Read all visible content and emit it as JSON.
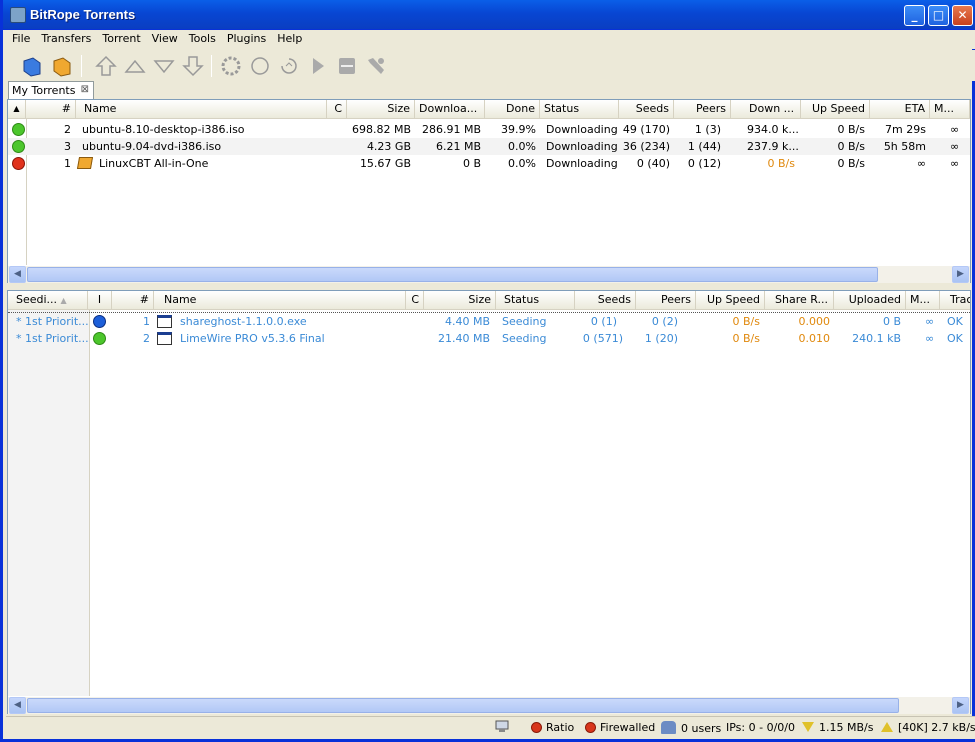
{
  "window": {
    "title": "BitRope Torrents",
    "min": "_",
    "max": "□",
    "close": "✕"
  },
  "menu": [
    "File",
    "Transfers",
    "Torrent",
    "View",
    "Tools",
    "Plugins",
    "Help"
  ],
  "tab": {
    "label": "My Torrents",
    "close": "⊠"
  },
  "torrents": {
    "columns": [
      "#",
      "Name",
      "C",
      "Size",
      "Downloa...",
      "Done",
      "Status",
      "Seeds",
      "Peers",
      "Down ...",
      "Up Speed",
      "ETA",
      "M..."
    ],
    "rows": [
      {
        "status_icon": "green-smiley-icon",
        "num": "2",
        "name": "ubuntu-8.10-desktop-i386.iso",
        "size": "698.82 MB",
        "downloaded": "286.91 MB",
        "done": "39.9%",
        "status": "Downloading",
        "seeds": "49 (170)",
        "peers": "1 (3)",
        "down": "934.0 k...",
        "up": "0 B/s",
        "eta": "7m 29s",
        "m": "∞"
      },
      {
        "status_icon": "green-smiley-icon",
        "num": "3",
        "name": "ubuntu-9.04-dvd-i386.iso",
        "size": "4.23 GB",
        "downloaded": "6.21 MB",
        "done": "0.0%",
        "status": "Downloading",
        "seeds": "36 (234)",
        "peers": "1 (44)",
        "down": "237.9 k...",
        "up": "0 B/s",
        "eta": "5h 58m",
        "m": "∞"
      },
      {
        "status_icon": "red-smiley-icon",
        "num": "1",
        "name": "LinuxCBT All-in-One",
        "size": "15.67 GB",
        "downloaded": "0 B",
        "done": "0.0%",
        "status": "Downloading",
        "seeds": "0 (40)",
        "peers": "0 (12)",
        "down": "0 B/s",
        "up": "0 B/s",
        "eta": "∞",
        "m": "∞"
      }
    ]
  },
  "seeding": {
    "columns": [
      "Seedi...",
      "I",
      "#",
      "Name",
      "C",
      "Size",
      "Status",
      "Seeds",
      "Peers",
      "Up Speed",
      "Share R...",
      "Uploaded",
      "M...",
      "Trac"
    ],
    "rows": [
      {
        "priority": "* 1st Priorit...",
        "icon": "blue-smiley-icon",
        "num": "1",
        "name": "shareghost-1.1.0.0.exe",
        "size": "4.40 MB",
        "status": "Seeding",
        "seeds": "0 (1)",
        "peers": "0 (2)",
        "up": "0 B/s",
        "ratio": "0.000",
        "uploaded": "0 B",
        "m": "∞",
        "trac": "OK"
      },
      {
        "priority": "* 1st Priorit...",
        "icon": "green-smiley-icon",
        "num": "2",
        "name": "LimeWire PRO v5.3.6 Final",
        "size": "21.40 MB",
        "status": "Seeding",
        "seeds": "0 (571)",
        "peers": "1 (20)",
        "up": "0 B/s",
        "ratio": "0.010",
        "uploaded": "240.1 kB",
        "m": "∞",
        "trac": "OK"
      }
    ]
  },
  "status": {
    "ratio": "Ratio",
    "firewall": "Firewalled",
    "users": "0 users",
    "ips": "IPs: 0 - 0/0/0",
    "down": "1.15 MB/s",
    "up": "[40K] 2.7 kB/s"
  },
  "colors": {
    "link_blue": "#3a8ad6",
    "orange": "#e0890e",
    "xp_title": "#0846d3"
  }
}
